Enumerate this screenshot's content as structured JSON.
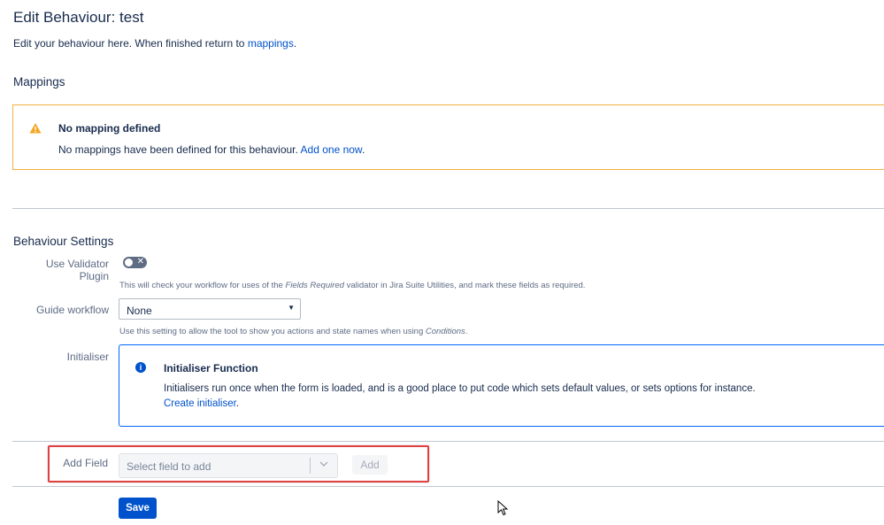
{
  "page": {
    "title": "Edit Behaviour: test",
    "intro_text": "Edit your behaviour here. When finished return to ",
    "intro_link": "mappings",
    "intro_end": "."
  },
  "mappings": {
    "heading": "Mappings",
    "warning_title": "No mapping defined",
    "warning_text": "No mappings have been defined for this behaviour. ",
    "warning_link": "Add one now",
    "warning_end": ".",
    "warning_icon": "warning-icon",
    "warning_color": "#f5a623"
  },
  "settings": {
    "heading": "Behaviour Settings",
    "validator_label": "Use Validator Plugin",
    "validator_enabled": false,
    "validator_help_pre": "This will check your workflow for uses of the ",
    "validator_help_em": "Fields Required",
    "validator_help_post": " validator in Jira Suite Utilities, and mark these fields as required.",
    "guide_label": "Guide workflow",
    "guide_value": "None",
    "guide_help_pre": "Use this setting to allow the tool to show you actions and state names when using ",
    "guide_help_em": "Conditions",
    "guide_help_post": ".",
    "initialiser_label": "Initialiser",
    "initialiser_title": "Initialiser Function",
    "initialiser_text": "Initialisers run once when the form is loaded, and is a good place to put code which sets default values, or sets options for instance.",
    "initialiser_link": "Create initialiser",
    "initialiser_end": "."
  },
  "add_field": {
    "label": "Add Field",
    "placeholder": "Select field to add",
    "add_button": "Add"
  },
  "footer": {
    "save_button": "Save"
  },
  "colors": {
    "link": "#0052cc",
    "primary_button": "#0052cc",
    "highlight_border": "#e0403f"
  }
}
